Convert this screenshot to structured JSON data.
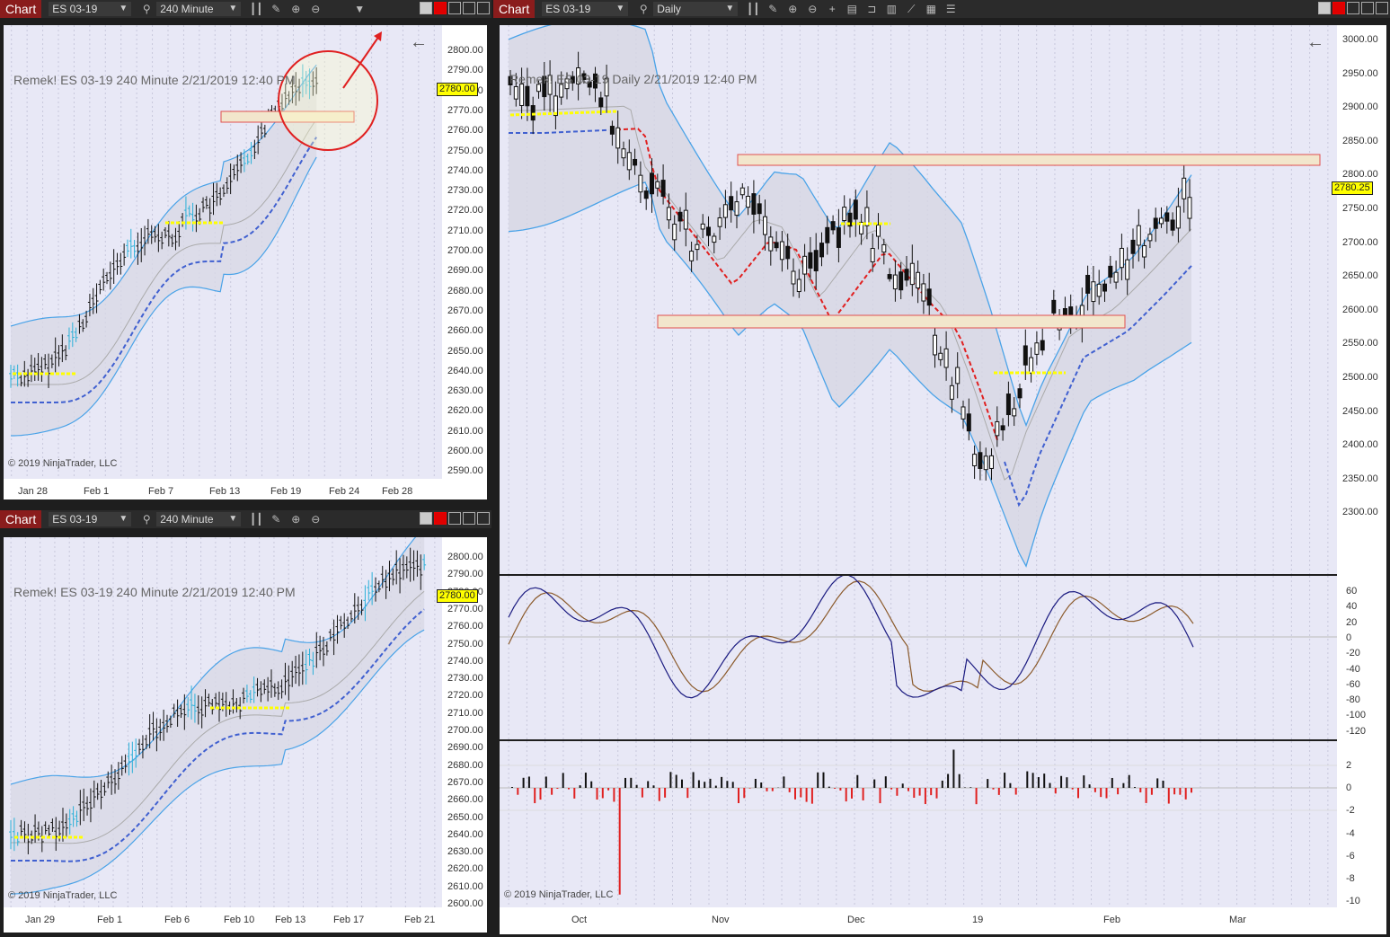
{
  "toolbar_common": {
    "chart_label": "Chart",
    "instrument": "ES 03-19"
  },
  "windows": {
    "tl": {
      "interval": "240 Minute",
      "title": "Remek!  ES 03-19  240 Minute  2/21/2019 12:40 PM",
      "price_tag": "2780.00",
      "copyright": "© 2019 NinjaTrader, LLC",
      "yticks": [
        "2800.00",
        "2790.00",
        "2780.00",
        "2770.00",
        "2760.00",
        "2750.00",
        "2740.00",
        "2730.00",
        "2720.00",
        "2710.00",
        "2700.00",
        "2690.00",
        "2680.00",
        "2670.00",
        "2660.00",
        "2650.00",
        "2640.00",
        "2630.00",
        "2620.00",
        "2610.00",
        "2600.00",
        "2590.00"
      ],
      "xticks": [
        "Jan 28",
        "Feb 1",
        "Feb 7",
        "Feb 13",
        "Feb 19",
        "Feb 24",
        "Feb 28"
      ]
    },
    "bl": {
      "interval": "240 Minute",
      "title": "Remek!  ES 03-19  240 Minute  2/21/2019 12:40 PM",
      "price_tag": "2780.00",
      "copyright": "© 2019 NinjaTrader, LLC",
      "yticks": [
        "2800.00",
        "2790.00",
        "2780.00",
        "2770.00",
        "2760.00",
        "2750.00",
        "2740.00",
        "2730.00",
        "2720.00",
        "2710.00",
        "2700.00",
        "2690.00",
        "2680.00",
        "2670.00",
        "2660.00",
        "2650.00",
        "2640.00",
        "2630.00",
        "2620.00",
        "2610.00",
        "2600.00"
      ],
      "xticks": [
        "Jan 29",
        "Feb 1",
        "Feb 6",
        "Feb 10",
        "Feb 13",
        "Feb 17",
        "Feb 21"
      ]
    },
    "right": {
      "interval": "Daily",
      "title": "Remek!  ES 03-19  Daily  2/21/2019 12:40 PM",
      "price_tag": "2780.25",
      "copyright": "© 2019 NinjaTrader, LLC",
      "yticks": [
        "3000.00",
        "2950.00",
        "2900.00",
        "2850.00",
        "2800.00",
        "2750.00",
        "2700.00",
        "2650.00",
        "2600.00",
        "2550.00",
        "2500.00",
        "2450.00",
        "2400.00",
        "2350.00",
        "2300.00"
      ],
      "osc_ticks": [
        "60",
        "40",
        "20",
        "0",
        "-20",
        "-40",
        "-60",
        "-80",
        "-100",
        "-120"
      ],
      "hist_ticks": [
        "2",
        "0",
        "-2",
        "-4",
        "-6",
        "-8",
        "-10"
      ],
      "xticks": [
        "Oct",
        "Nov",
        "Dec",
        "19",
        "Feb",
        "Mar"
      ]
    }
  },
  "colors": {
    "bg": "#1e1e1e",
    "plot": "#e8e8f6",
    "band": "#4aa3e8",
    "bull": "#2ab0d8",
    "red": "#e02020",
    "yellow": "#ffff00",
    "blue_dash": "#4060d0"
  }
}
